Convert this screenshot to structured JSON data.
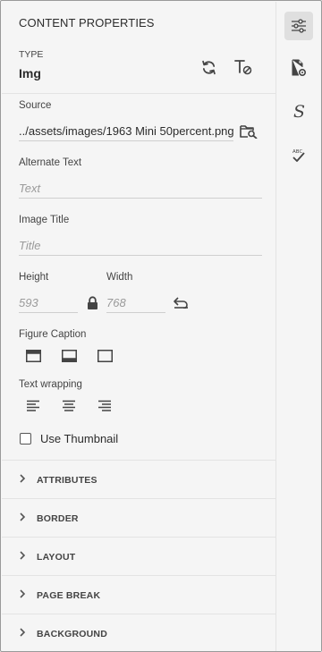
{
  "panel": {
    "header": "CONTENT PROPERTIES",
    "type_label": "TYPE",
    "type_value": "Img",
    "source": {
      "label": "Source",
      "value": "../assets/images/1963 Mini 50percent.png"
    },
    "alt_text": {
      "label": "Alternate Text",
      "placeholder": "Text"
    },
    "image_title": {
      "label": "Image Title",
      "placeholder": "Title"
    },
    "height": {
      "label": "Height",
      "placeholder": "593"
    },
    "width": {
      "label": "Width",
      "placeholder": "768"
    },
    "figure_caption_label": "Figure Caption",
    "text_wrapping_label": "Text wrapping",
    "use_thumbnail_label": "Use Thumbnail",
    "sections": [
      {
        "label": "ATTRIBUTES"
      },
      {
        "label": "BORDER"
      },
      {
        "label": "LAYOUT"
      },
      {
        "label": "PAGE BREAK"
      },
      {
        "label": "BACKGROUND"
      }
    ]
  },
  "rail": {
    "items": [
      "content-properties-icon",
      "page-settings-icon",
      "styles-icon",
      "spell-check-icon"
    ],
    "active": "content-properties-icon"
  },
  "colors": {
    "panel_bg": "#f5f5f5",
    "text": "#2c2c2c",
    "muted": "#9a9a9a",
    "divider": "#e3e3e3"
  }
}
